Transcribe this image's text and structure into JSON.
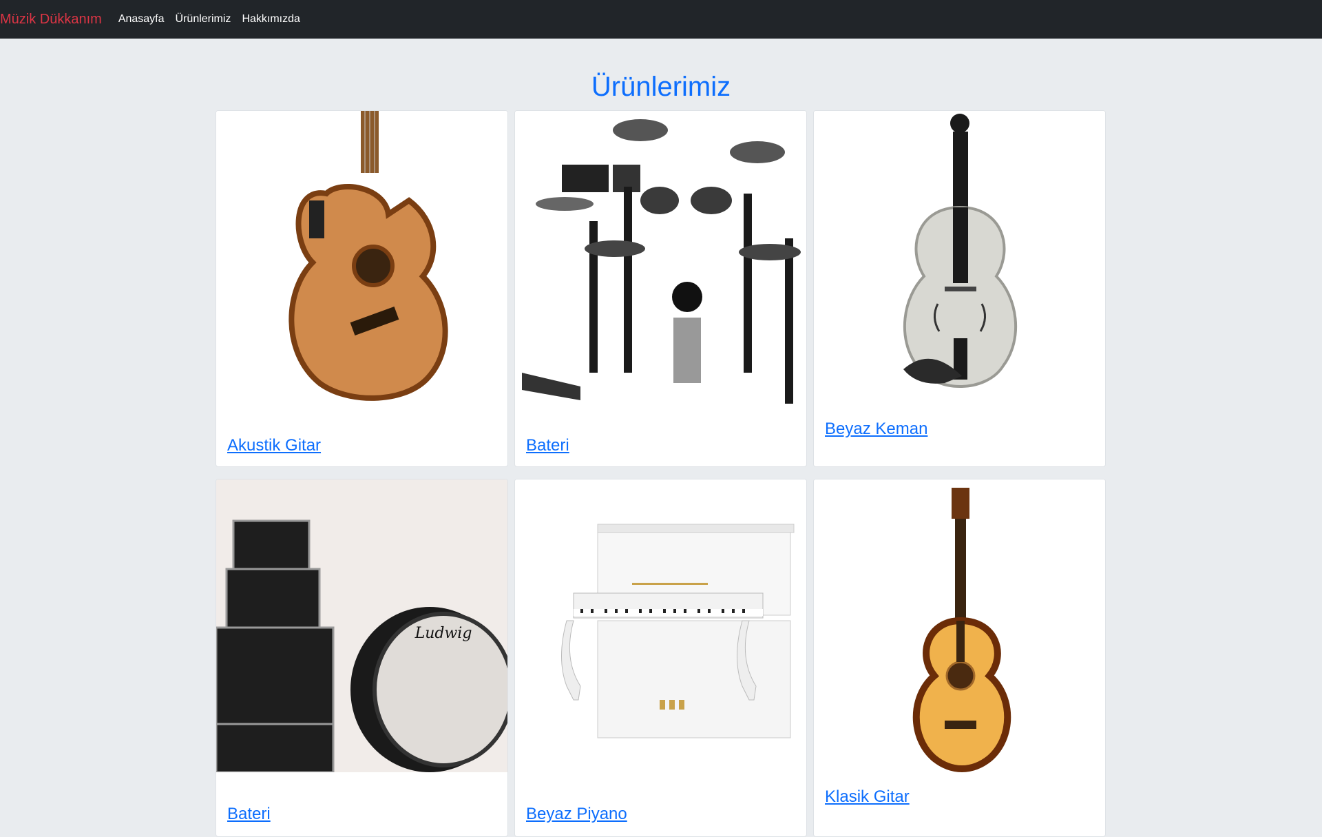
{
  "navbar": {
    "brand": "Müzik Dükkanım",
    "links": [
      "Anasayfa",
      "Ürünlerimiz",
      "Hakkımızda"
    ]
  },
  "page": {
    "title": "Ürünlerimiz"
  },
  "products": [
    {
      "name": "Akustik Gitar",
      "image_icon": "acoustic-guitar-image"
    },
    {
      "name": "Bateri",
      "image_icon": "electronic-drum-kit-image"
    },
    {
      "name": "Beyaz Keman",
      "image_icon": "white-violin-image"
    },
    {
      "name": "Bateri",
      "image_icon": "acoustic-drum-kit-image"
    },
    {
      "name": "Beyaz Piyano",
      "image_icon": "white-piano-image"
    },
    {
      "name": "Klasik Gitar",
      "image_icon": "classical-guitar-image"
    }
  ],
  "colors": {
    "navbar_bg": "#212529",
    "brand": "#dc3545",
    "link": "#0d6efd",
    "page_bg": "#e9ecef"
  }
}
